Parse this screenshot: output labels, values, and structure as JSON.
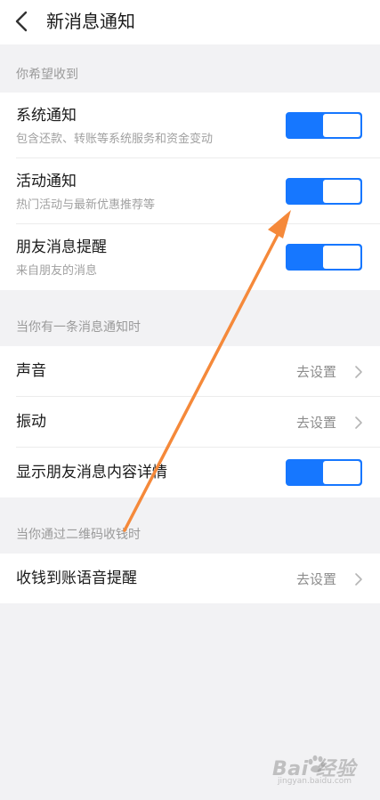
{
  "nav": {
    "title": "新消息通知"
  },
  "sections": {
    "receive": "你希望收到",
    "on_message": "当你有一条消息通知时",
    "on_qr": "当你通过二维码收钱时"
  },
  "notifications": [
    {
      "title": "系统通知",
      "subtitle": "包含还款、转账等系统服务和资金变动",
      "enabled": true
    },
    {
      "title": "活动通知",
      "subtitle": "热门活动与最新优惠推荐等",
      "enabled": true
    },
    {
      "title": "朋友消息提醒",
      "subtitle": "来自朋友的消息",
      "enabled": true
    }
  ],
  "message_settings": {
    "sound": {
      "title": "声音",
      "action": "去设置"
    },
    "vibrate": {
      "title": "振动",
      "action": "去设置"
    },
    "show_details": {
      "title": "显示朋友消息内容详情",
      "enabled": true
    }
  },
  "qr_settings": {
    "voice": {
      "title": "收钱到账语音提醒",
      "action": "去设置"
    }
  },
  "watermark": {
    "main": "Bai 经验",
    "sub": "jingyan.baidu.com"
  },
  "colors": {
    "accent": "#1677ff",
    "annotation_arrow": "#f5893a",
    "background": "#f2f2f4"
  },
  "icons": {
    "back": "back-chevron-icon",
    "row_chevron": "chevron-right-icon",
    "watermark": "baidu-paw-icon"
  }
}
